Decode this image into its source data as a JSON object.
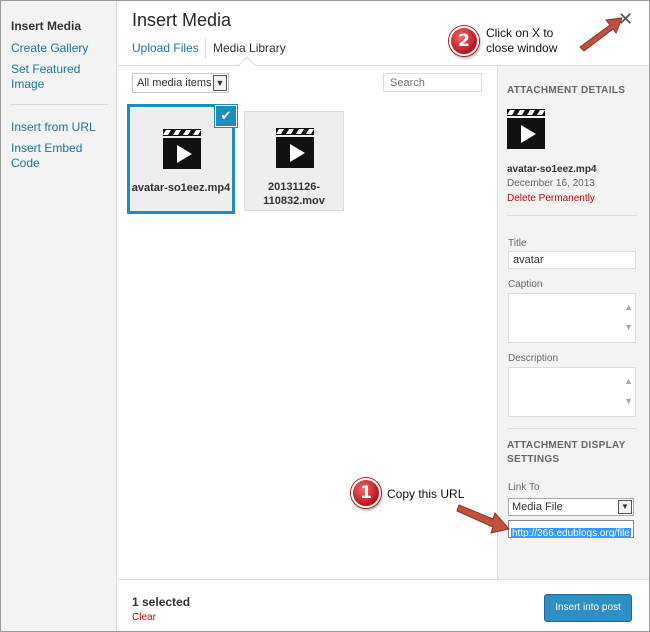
{
  "sidebar": {
    "items": [
      {
        "label": "Insert Media"
      },
      {
        "label": "Create Gallery"
      },
      {
        "label": "Set Featured Image"
      },
      {
        "label": "Insert from URL"
      },
      {
        "label": "Insert Embed Code"
      }
    ]
  },
  "header": {
    "title": "Insert Media",
    "tabs": [
      {
        "label": "Upload Files"
      },
      {
        "label": "Media Library"
      }
    ],
    "close_icon": "close-icon"
  },
  "toolbar": {
    "filter_value": "All media items",
    "search_placeholder": "Search"
  },
  "attachments": [
    {
      "name": "avatar-so1eez.mp4",
      "selected": true,
      "icon": "video-file-icon"
    },
    {
      "name": "20131126-110832.mov",
      "selected": false,
      "icon": "video-file-icon"
    }
  ],
  "details": {
    "heading": "ATTACHMENT DETAILS",
    "filename": "avatar-so1eez.mp4",
    "date": "December 16, 2013",
    "delete_label": "Delete Permanently",
    "title_label": "Title",
    "title_value": "avatar",
    "caption_label": "Caption",
    "description_label": "Description"
  },
  "display_settings": {
    "heading": "ATTACHMENT DISPLAY SETTINGS",
    "link_to_label": "Link To",
    "link_to_value": "Media File",
    "url_value": "http://366.edublogs.org/file"
  },
  "footer": {
    "selected_count": "1 selected",
    "clear_label": "Clear",
    "insert_label": "Insert into post"
  },
  "annotations": {
    "step1_number": "1",
    "step1_text": "Copy this URL",
    "step2_number": "2",
    "step2_text": "Click on X to close window",
    "color": "#b9121b",
    "arrow_color": "#c0503f"
  },
  "colors": {
    "accent": "#1e8cbe",
    "link": "#21759b",
    "danger": "#bc0b0b"
  }
}
